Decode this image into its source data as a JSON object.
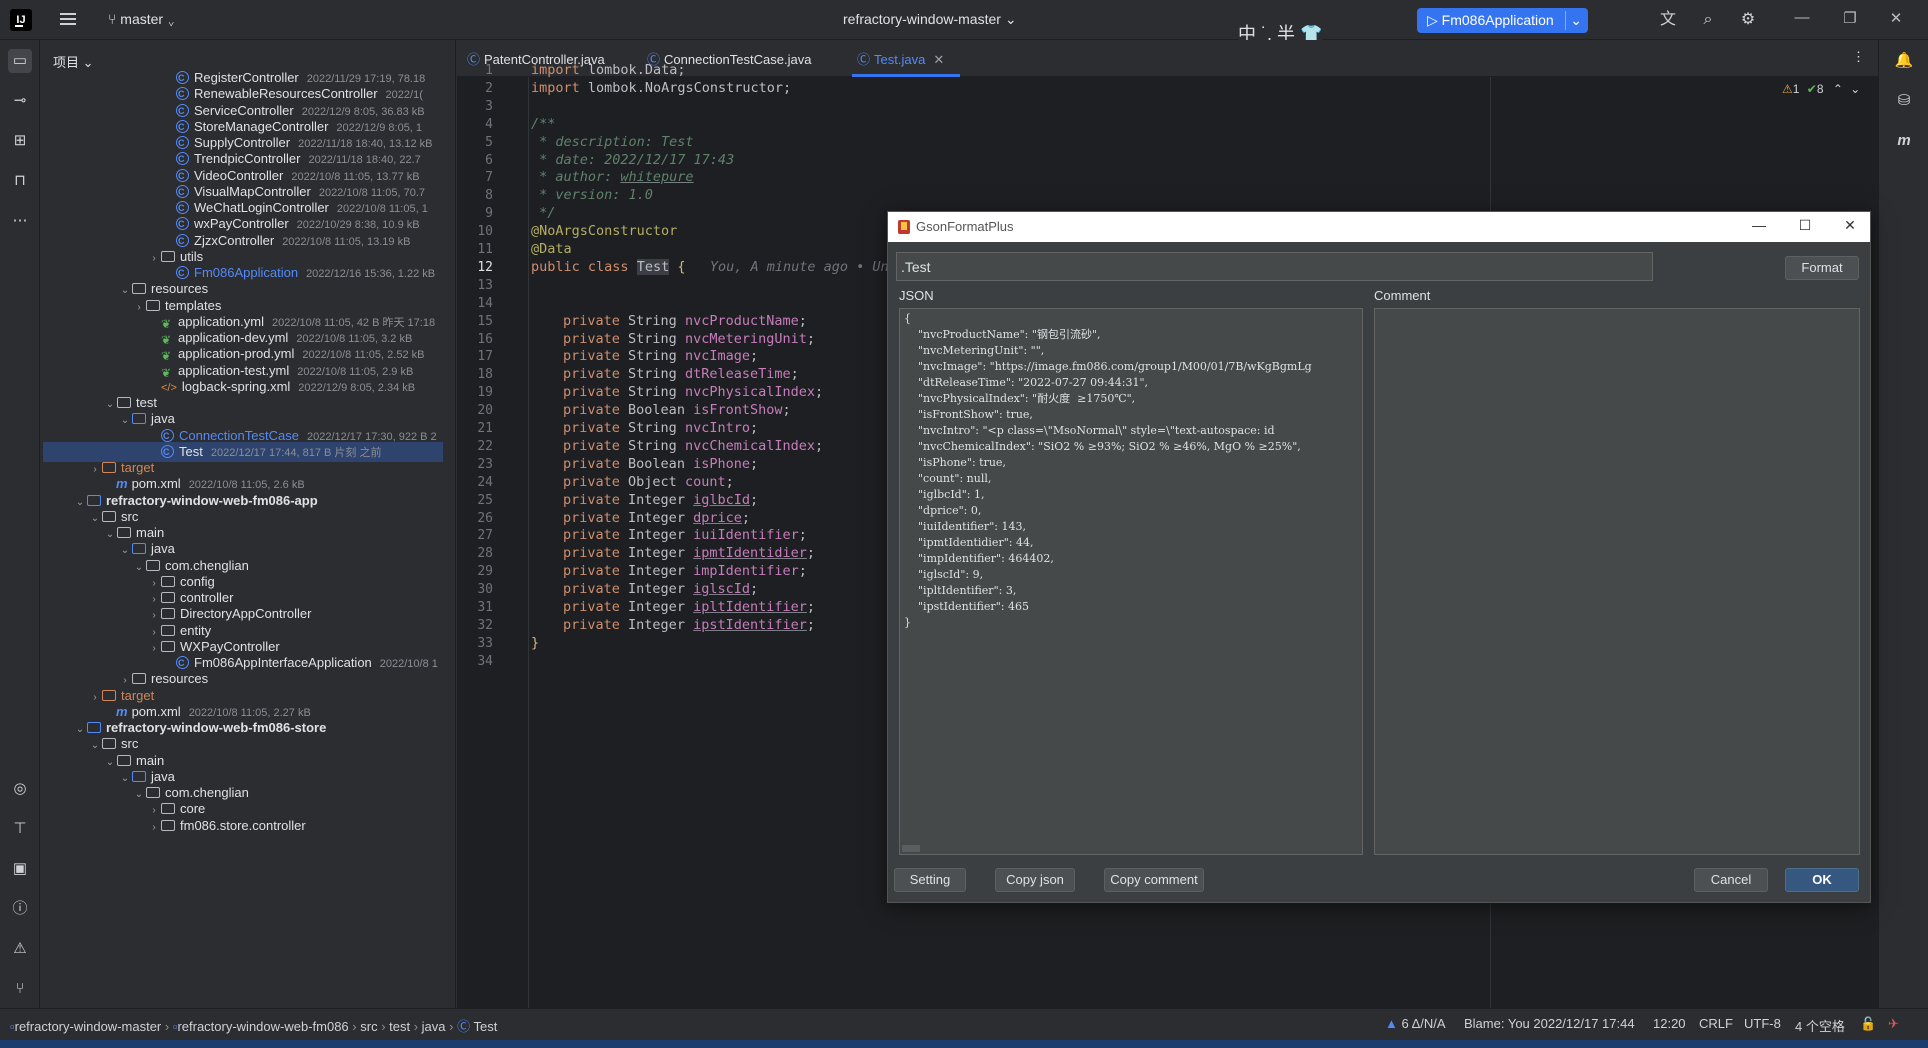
{
  "titlebar": {
    "logo": "IJ",
    "branch": "master",
    "project": "refractory-window-master",
    "ime": "中 ˙, 半",
    "run_config": "Fm086Application"
  },
  "project_panel": {
    "header": "项目",
    "rows": [
      {
        "name": "RegisterController",
        "meta": "2022/11/29 17:19, 78.18"
      },
      {
        "name": "RenewableResourcesController",
        "meta": "2022/1("
      },
      {
        "name": "ServiceController",
        "meta": "2022/12/9 8:05, 36.83 kB"
      },
      {
        "name": "StoreManageController",
        "meta": "2022/12/9 8:05, 1"
      },
      {
        "name": "SupplyController",
        "meta": "2022/11/18 18:40, 13.12 kB"
      },
      {
        "name": "TrendpicController",
        "meta": "2022/11/18 18:40, 22.7"
      },
      {
        "name": "VideoController",
        "meta": "2022/10/8 11:05, 13.77 kB"
      },
      {
        "name": "VisualMapController",
        "meta": "2022/10/8 11:05, 70.7"
      },
      {
        "name": "WeChatLoginController",
        "meta": "2022/10/8 11:05, 1"
      },
      {
        "name": "wxPayController",
        "meta": "2022/10/29 8:38, 10.9 kB"
      },
      {
        "name": "ZjzxController",
        "meta": "2022/10/8 11:05, 13.19 kB"
      },
      {
        "name": "utils",
        "meta": ""
      },
      {
        "name": "Fm086Application",
        "meta": "2022/12/16 15:36, 1.22 kB"
      },
      {
        "name": "resources",
        "meta": ""
      },
      {
        "name": "templates",
        "meta": ""
      },
      {
        "name": "application.yml",
        "meta": "2022/10/8 11:05, 42 B 昨天 17:18"
      },
      {
        "name": "application-dev.yml",
        "meta": "2022/10/8 11:05, 3.2 kB"
      },
      {
        "name": "application-prod.yml",
        "meta": "2022/10/8 11:05, 2.52 kB"
      },
      {
        "name": "application-test.yml",
        "meta": "2022/10/8 11:05, 2.9 kB"
      },
      {
        "name": "logback-spring.xml",
        "meta": "2022/12/9 8:05, 2.34 kB"
      },
      {
        "name": "test",
        "meta": ""
      },
      {
        "name": "java",
        "meta": ""
      },
      {
        "name": "ConnectionTestCase",
        "meta": "2022/12/17 17:30, 922 B 2"
      },
      {
        "name": "Test",
        "meta": "2022/12/17 17:44, 817 B 片刻 之前"
      },
      {
        "name": "target",
        "meta": ""
      },
      {
        "name": "pom.xml",
        "meta": "2022/10/8 11:05, 2.6 kB"
      },
      {
        "name": "refractory-window-web-fm086-app",
        "meta": ""
      },
      {
        "name": "src",
        "meta": ""
      },
      {
        "name": "main",
        "meta": ""
      },
      {
        "name": "java",
        "meta": ""
      },
      {
        "name": "com.chenglian",
        "meta": ""
      },
      {
        "name": "config",
        "meta": ""
      },
      {
        "name": "controller",
        "meta": ""
      },
      {
        "name": "DirectoryAppController",
        "meta": ""
      },
      {
        "name": "entity",
        "meta": ""
      },
      {
        "name": "WXPayController",
        "meta": ""
      },
      {
        "name": "Fm086AppInterfaceApplication",
        "meta": "2022/10/8 1"
      },
      {
        "name": "resources",
        "meta": ""
      },
      {
        "name": "target",
        "meta": ""
      },
      {
        "name": "pom.xml",
        "meta": "2022/10/8 11:05, 2.27 kB"
      },
      {
        "name": "refractory-window-web-fm086-store",
        "meta": ""
      },
      {
        "name": "src",
        "meta": ""
      },
      {
        "name": "main",
        "meta": ""
      },
      {
        "name": "java",
        "meta": ""
      },
      {
        "name": "com.chenglian",
        "meta": ""
      },
      {
        "name": "core",
        "meta": ""
      },
      {
        "name": "fm086.store.controller",
        "meta": ""
      }
    ]
  },
  "tabs": [
    {
      "label": "PatentController.java"
    },
    {
      "label": "ConnectionTestCase.java"
    },
    {
      "label": "Test.java"
    }
  ],
  "editor": {
    "warnings": "1",
    "checks": "8",
    "line_numbers": [
      "1",
      "2",
      "3",
      "4",
      "5",
      "6",
      "7",
      "8",
      "9",
      "10",
      "11",
      "12",
      "13",
      "14",
      "15",
      "16",
      "17",
      "18",
      "19",
      "20",
      "21",
      "22",
      "23",
      "24",
      "25",
      "26",
      "27",
      "28",
      "29",
      "30",
      "31",
      "32",
      "33",
      "34"
    ],
    "import1": "lombok.Data;",
    "import2": "lombok.NoArgsConstructor;",
    "doc_open": "/**",
    "doc_desc": " * description: Test",
    "doc_date": " * date: 2022/12/17 17:43",
    "doc_author_prefix": " * author: ",
    "doc_author": "whitepure",
    "doc_version": " * version: 1.0",
    "doc_close": " */",
    "anno1": "@NoArgsConstructor",
    "anno2": "@Data",
    "class_name": "Test",
    "blame_hint": "You, A minute ago • Unc",
    "fields": [
      {
        "type": "String",
        "name": "nvcProductName",
        "ul": false
      },
      {
        "type": "String",
        "name": "nvcMeteringUnit",
        "ul": false
      },
      {
        "type": "String",
        "name": "nvcImage",
        "ul": false
      },
      {
        "type": "String",
        "name": "dtReleaseTime",
        "ul": false
      },
      {
        "type": "String",
        "name": "nvcPhysicalIndex",
        "ul": false
      },
      {
        "type": "Boolean",
        "name": "isFrontShow",
        "ul": false
      },
      {
        "type": "String",
        "name": "nvcIntro",
        "ul": false
      },
      {
        "type": "String",
        "name": "nvcChemicalIndex",
        "ul": false
      },
      {
        "type": "Boolean",
        "name": "isPhone",
        "ul": false
      },
      {
        "type": "Object",
        "name": "count",
        "ul": false
      },
      {
        "type": "Integer",
        "name": "iglbcId",
        "ul": true
      },
      {
        "type": "Integer",
        "name": "dprice",
        "ul": true
      },
      {
        "type": "Integer",
        "name": "iuiIdentifier",
        "ul": false
      },
      {
        "type": "Integer",
        "name": "ipmtIdentidier",
        "ul": true
      },
      {
        "type": "Integer",
        "name": "impIdentifier",
        "ul": false
      },
      {
        "type": "Integer",
        "name": "iglscId",
        "ul": true
      },
      {
        "type": "Integer",
        "name": "ipltIdentifier",
        "ul": true
      },
      {
        "type": "Integer",
        "name": "ipstIdentifier",
        "ul": true
      }
    ]
  },
  "dialog": {
    "title": "GsonFormatPlus",
    "class_name_value": ".Test",
    "format_label": "Format",
    "json_label": "JSON",
    "comment_label": "Comment",
    "json_lines": [
      "{",
      "    \"nvcProductName\": \"钢包引流砂\",",
      "    \"nvcMeteringUnit\": \"\",",
      "    \"nvcImage\": \"https://image.fm086.com/group1/M00/01/7B/wKgBgmLg",
      "    \"dtReleaseTime\": \"2022-07-27 09:44:31\",",
      "    \"nvcPhysicalIndex\": \"耐火度  ≥1750℃\",",
      "    \"isFrontShow\": true,",
      "    \"nvcIntro\": \"<p class=\\\"MsoNormal\\\" style=\\\"text-autospace: id",
      "    \"nvcChemicalIndex\": \"SiO2 % ≥93%; SiO2 % ≥46%, MgO % ≥25%\",",
      "    \"isPhone\": true,",
      "    \"count\": null,",
      "    \"iglbcId\": 1,",
      "    \"dprice\": 0,",
      "    \"iuiIdentifier\": 143,",
      "    \"ipmtIdentidier\": 44,",
      "    \"impIdentifier\": 464402,",
      "    \"iglscId\": 9,",
      "    \"ipltIdentifier\": 3,",
      "    \"ipstIdentifier\": 465",
      "}"
    ],
    "setting_label": "Setting",
    "copy_json_label": "Copy  json",
    "copy_comment_label": "Copy comment",
    "cancel_label": "Cancel",
    "ok_label": "OK"
  },
  "statusbar": {
    "crumbs": [
      "refractory-window-master",
      "refractory-window-web-fm086",
      "src",
      "test",
      "java",
      "Test"
    ],
    "problems": "6 Δ/N/A",
    "blame": "Blame: You 2022/12/17 17:44",
    "position": "12:20",
    "line_sep": "CRLF",
    "encoding": "UTF-8",
    "indent": "4 个空格"
  },
  "colors": {
    "accent": "#3574f0",
    "bg": "#2b2d30",
    "editor_bg": "#1e1f22",
    "keyword": "#cf8e6d",
    "field": "#c77dbb"
  }
}
